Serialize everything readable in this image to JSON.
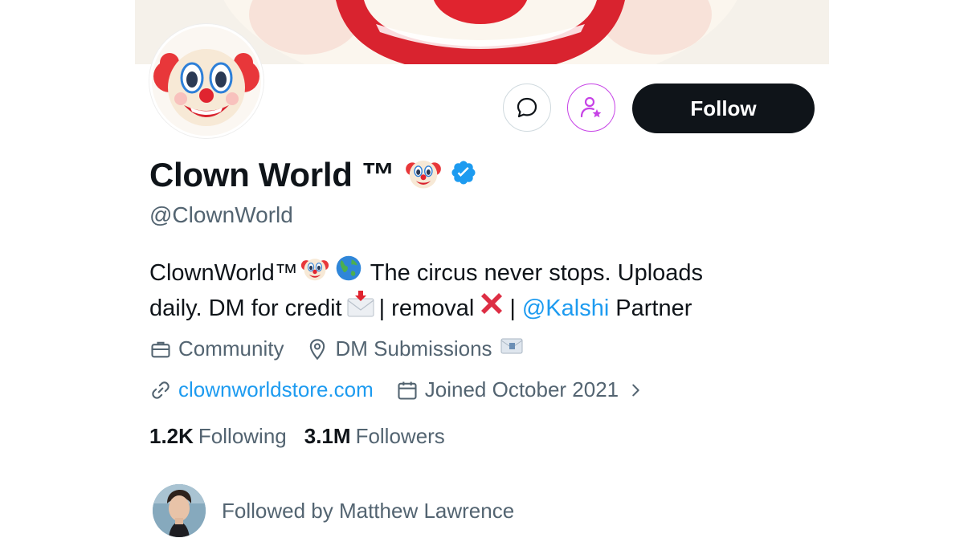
{
  "profile": {
    "display_name": "Clown World ™",
    "handle": "@ClownWorld",
    "verified": true,
    "buttons": {
      "message_icon": "message-bubble-icon",
      "subscribe_icon": "person-star-icon",
      "follow_label": "Follow"
    },
    "bio": {
      "line1_name": "ClownWorld™",
      "line1_text": "The circus never stops. Uploads",
      "line2_text": "daily. DM for credit",
      "line2_sep1": "| removal",
      "line2_sep2": "|",
      "mention": "@Kalshi",
      "line2_end": "Partner"
    },
    "meta": {
      "category": "Community",
      "location": "DM Submissions",
      "website": "clownworldstore.com",
      "joined": "Joined October 2021"
    },
    "stats": {
      "following_count": "1.2K",
      "following_label": "Following",
      "followers_count": "3.1M",
      "followers_label": "Followers"
    },
    "followed_by": "Followed by Matthew Lawrence"
  },
  "colors": {
    "accent": "#1d9bf0",
    "text": "#0f1419",
    "secondary": "#536471",
    "follow_bg": "#0f1419",
    "subscribe": "#c642e6"
  }
}
